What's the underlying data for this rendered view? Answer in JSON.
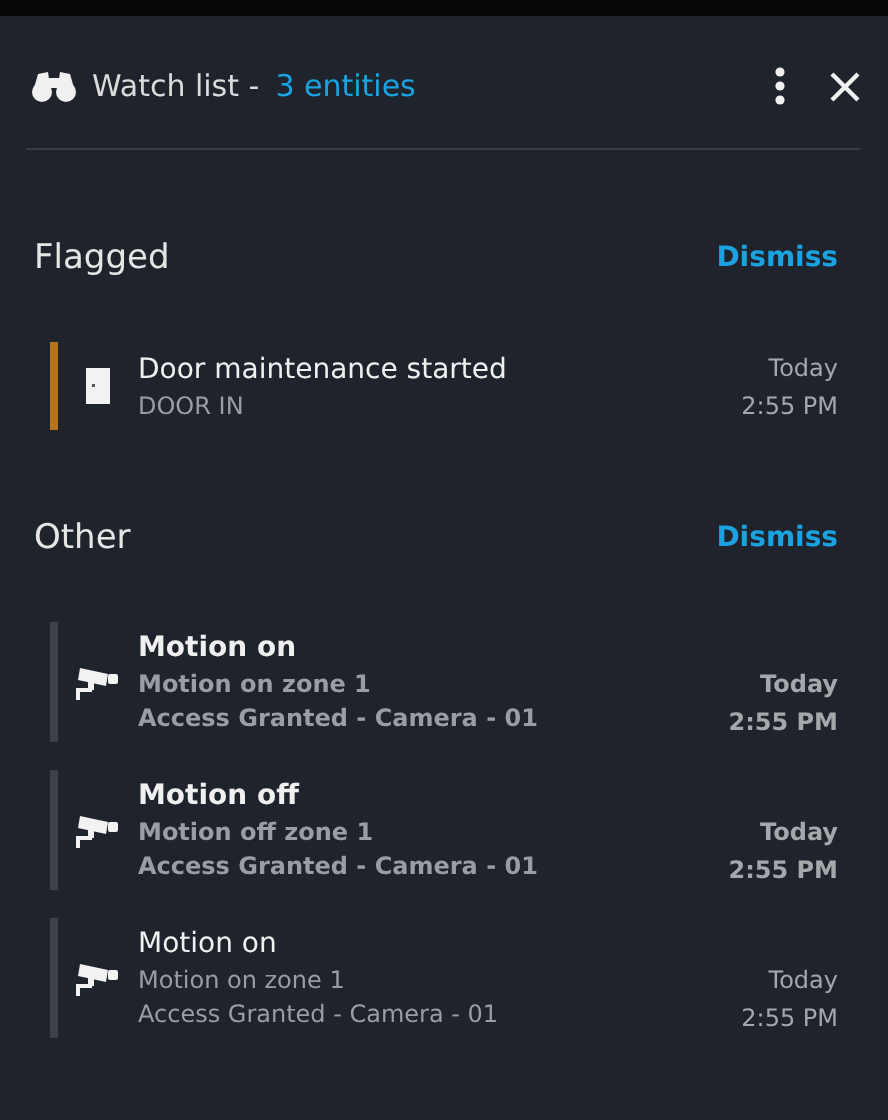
{
  "header": {
    "title": "Watch list -",
    "count": "3 entities"
  },
  "sections": [
    {
      "title": "Flagged",
      "action": "Dismiss",
      "items": [
        {
          "kind": "door",
          "color": "#b8741a",
          "unread": false,
          "title": "Door maintenance started",
          "lines": [
            "DOOR IN"
          ],
          "day": "Today",
          "time": "2:55 PM"
        }
      ]
    },
    {
      "title": "Other",
      "action": "Dismiss",
      "items": [
        {
          "kind": "camera",
          "color": "#3d4249",
          "unread": true,
          "title": "Motion on",
          "lines": [
            "Motion on zone 1",
            "Access Granted - Camera - 01"
          ],
          "day": "Today",
          "time": "2:55 PM"
        },
        {
          "kind": "camera",
          "color": "#3d4249",
          "unread": true,
          "title": "Motion off",
          "lines": [
            "Motion off zone 1",
            "Access Granted - Camera - 01"
          ],
          "day": "Today",
          "time": "2:55 PM"
        },
        {
          "kind": "camera",
          "color": "#3d4249",
          "unread": false,
          "title": "Motion on",
          "lines": [
            "Motion on zone 1",
            "Access Granted - Camera - 01"
          ],
          "day": "Today",
          "time": "2:55 PM"
        }
      ]
    }
  ]
}
